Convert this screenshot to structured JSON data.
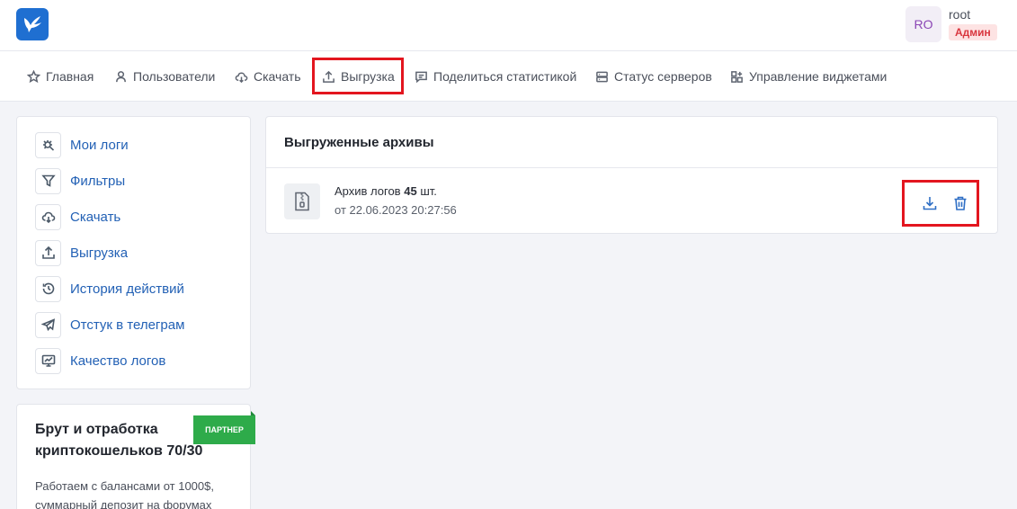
{
  "header": {
    "user_initials": "RO",
    "user_name": "root",
    "user_role": "Админ"
  },
  "nav": {
    "items": [
      {
        "label": "Главная",
        "icon": "star-icon"
      },
      {
        "label": "Пользователи",
        "icon": "user-icon"
      },
      {
        "label": "Скачать",
        "icon": "cloud-download-icon"
      },
      {
        "label": "Выгрузка",
        "icon": "upload-icon"
      },
      {
        "label": "Поделиться статистикой",
        "icon": "share-stats-icon"
      },
      {
        "label": "Статус серверов",
        "icon": "server-icon"
      },
      {
        "label": "Управление виджетами",
        "icon": "widgets-icon"
      }
    ]
  },
  "sidebar": {
    "items": [
      {
        "label": "Мои логи",
        "icon": "bug-search-icon"
      },
      {
        "label": "Фильтры",
        "icon": "filter-icon"
      },
      {
        "label": "Скачать",
        "icon": "cloud-download-icon"
      },
      {
        "label": "Выгрузка",
        "icon": "upload-icon"
      },
      {
        "label": "История действий",
        "icon": "history-icon"
      },
      {
        "label": "Отстук в телеграм",
        "icon": "telegram-icon"
      },
      {
        "label": "Качество логов",
        "icon": "monitor-chart-icon"
      }
    ]
  },
  "promo": {
    "title": "Брут и отработка криптокошельков 70/30",
    "badge": "ПАРТНЕР",
    "text": "Работаем с балансами от 1000$, суммарный депозит на форумах"
  },
  "archives": {
    "title": "Выгруженные архивы",
    "item": {
      "prefix": "Архив логов",
      "count": "45",
      "suffix": "шт.",
      "date": "от 22.06.2023 20:27:56"
    }
  },
  "colors": {
    "accent": "#1f6fd1",
    "highlight": "#e3161f",
    "link": "#2361b5",
    "badge": "#2eab4a"
  }
}
